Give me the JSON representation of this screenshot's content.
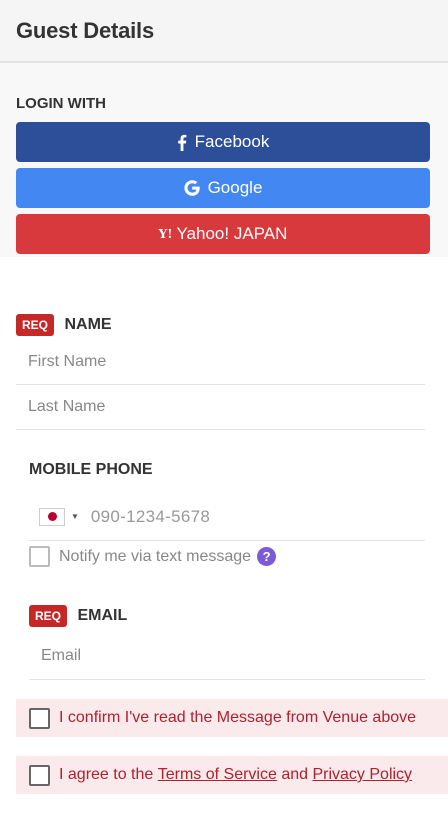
{
  "header": {
    "title": "Guest Details"
  },
  "login": {
    "title": "LOGIN WITH",
    "facebook": "Facebook",
    "google": "Google",
    "yahoo": "Yahoo! JAPAN",
    "yahoo_icon_text": "Y!"
  },
  "name": {
    "req_badge": "REQ",
    "label": "NAME",
    "first_placeholder": "First Name",
    "last_placeholder": "Last Name"
  },
  "phone": {
    "label": "MOBILE PHONE",
    "placeholder": "090-1234-5678",
    "country_flag": "japan-flag",
    "notify_label": "Notify me via text message",
    "help_icon": "?"
  },
  "email": {
    "req_badge": "REQ",
    "label": "EMAIL",
    "placeholder": "Email"
  },
  "agreements": {
    "confirm_label": "I confirm I've read the Message from Venue above",
    "agree_prefix": "I agree to the ",
    "terms_link": "Terms of Service",
    "agree_and": " and ",
    "privacy_link": "Privacy Policy"
  },
  "colors": {
    "facebook": "#2d4f99",
    "google": "#4388f2",
    "yahoo": "#d8393c",
    "required": "#c62828",
    "help": "#7b5bd6",
    "agreement_text": "#b0202d",
    "agreement_bg": "#fbeaec"
  }
}
